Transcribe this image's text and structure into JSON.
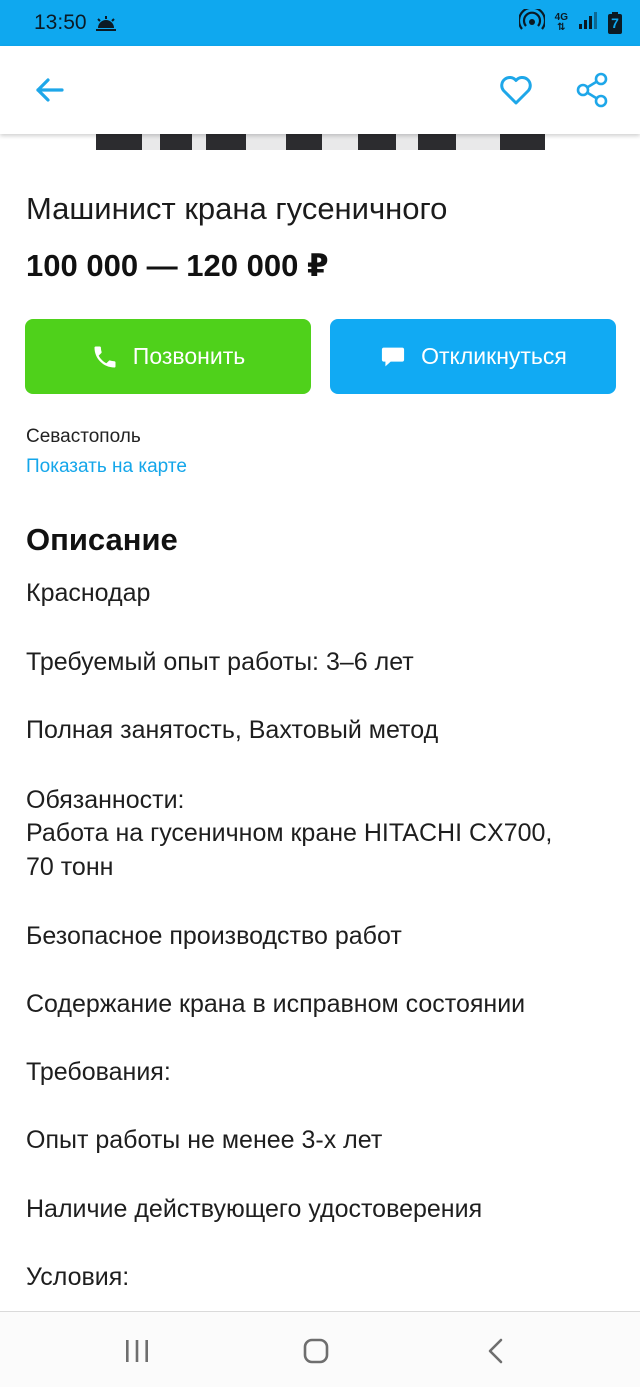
{
  "status_bar": {
    "time": "13:50",
    "network_label": "4G",
    "battery_level": "7",
    "color": "#0fa8ef"
  },
  "app_bar": {
    "icons": [
      "back-arrow-icon",
      "heart-icon",
      "share-icon"
    ],
    "accent": "#1ea7e9"
  },
  "vacancy": {
    "title": "Машинист крана гусеничного",
    "price": "100 000 — 120 000 ₽",
    "call_label": "Позвонить",
    "reply_label": "Откликнуться",
    "call_color": "#4fd11b",
    "reply_color": "#11aaf3",
    "city": "Севастополь",
    "map_link": "Показать на карте"
  },
  "description": {
    "heading": "Описание",
    "lines": [
      "Краснодар",
      "Требуемый опыт работы: 3–6 лет",
      "Полная занятость, Вахтовый метод",
      "Обязанности:",
      "Работа на гусеничном кране HITACHI CX700,",
      "70 тонн",
      "Безопасное производство работ",
      "Содержание крана в исправном состоянии",
      "Требования:",
      "Опыт работы не менее 3-х лет",
      "Наличие действующего удостоверения",
      "Условия:"
    ]
  },
  "nav_bar": {
    "icons": [
      "recent-apps-icon",
      "home-icon",
      "back-icon"
    ]
  }
}
